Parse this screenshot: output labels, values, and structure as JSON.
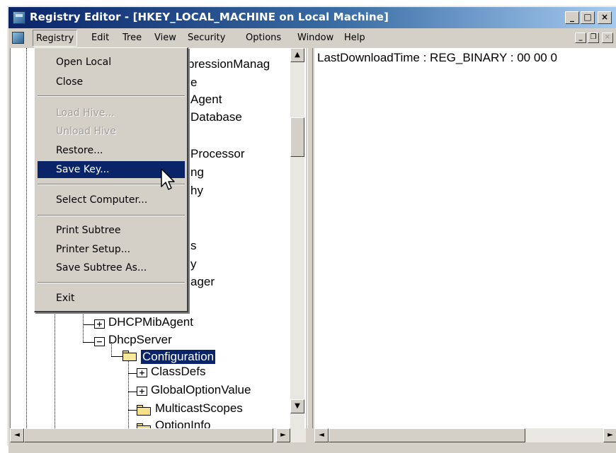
{
  "window": {
    "title": "Registry Editor - [HKEY_LOCAL_MACHINE on Local Machine]",
    "icon": "registry-editor-icon"
  },
  "caption_buttons": {
    "minimize": "_",
    "maximize": "□",
    "close": "×"
  },
  "menubar": {
    "items": [
      "Registry",
      "Edit",
      "Tree",
      "View",
      "Security",
      "Options",
      "Window",
      "Help"
    ],
    "active": "Registry",
    "mdi_buttons": {
      "minimize": "_",
      "restore": "❐",
      "close": "×"
    }
  },
  "registry_menu": {
    "groups": [
      [
        "Open Local",
        "Close"
      ],
      [
        "Load Hive...",
        "Unload Hive",
        "Restore...",
        "Save Key..."
      ],
      [
        "Select Computer..."
      ],
      [
        "Print Subtree",
        "Printer Setup...",
        "Save Subtree As..."
      ],
      [
        "Exit"
      ]
    ],
    "disabled": [
      "Load Hive...",
      "Unload Hive"
    ],
    "highlighted": "Save Key..."
  },
  "tree": {
    "partial_labels": [
      "pressionManag",
      "e",
      "Agent",
      "Database",
      "Processor",
      "ng",
      "hy",
      "s",
      "y",
      "ager"
    ],
    "nodes": [
      {
        "label": "DHCPMibAgent",
        "expander": "+"
      },
      {
        "label": "DhcpServer",
        "expander": "−"
      },
      {
        "label": "Configuration",
        "selected": true
      },
      {
        "label": "ClassDefs",
        "expander": "+"
      },
      {
        "label": "GlobalOptionValue",
        "expander": "+"
      },
      {
        "label": "MulticastScopes"
      },
      {
        "label": "OptionInfo"
      }
    ]
  },
  "values": {
    "line": "LastDownloadTime : REG_BINARY : 00 00 0"
  },
  "scroll_arrows": {
    "up": "▲",
    "down": "▼",
    "left": "◄",
    "right": "►"
  }
}
